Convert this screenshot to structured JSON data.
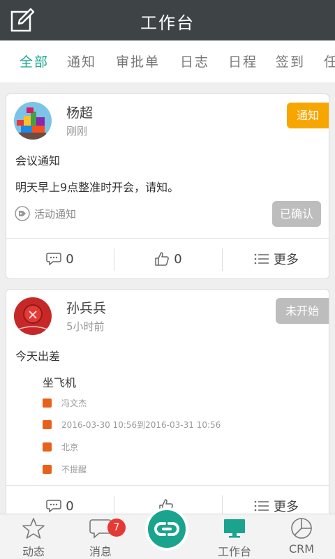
{
  "header": {
    "title": "工作台",
    "edit_icon": "edit-icon"
  },
  "tabs": [
    "全部",
    "通知",
    "审批单",
    "日志",
    "日程",
    "签到",
    "任"
  ],
  "active_tab": 0,
  "colors": {
    "accent": "#1aa48e",
    "header_bg": "#3e4346",
    "notice_badge": "#f7a600",
    "muted_badge": "#bdbdbd",
    "bullet": "#e8611a",
    "unread": "#e53935"
  },
  "card1": {
    "name": "杨超",
    "time": "刚刚",
    "badge": "通知",
    "title": "会议通知",
    "content": "明天早上9点整准时开会，请知。",
    "tag": "活动通知",
    "confirm": "已确认",
    "comments": "0",
    "likes": "0",
    "more": "更多"
  },
  "card2": {
    "name": "孙兵兵",
    "time": "5小时前",
    "badge": "未开始",
    "title": "今天出差",
    "subtitle": "坐飞机",
    "details": [
      "冯文杰",
      "2016-03-30 10:56到2016-03-31 10:56",
      "北京",
      "不提醒"
    ],
    "comments": "0",
    "more": "更多"
  },
  "bottom_nav": [
    {
      "label": "动态",
      "icon": "star-icon"
    },
    {
      "label": "消息",
      "icon": "chat-icon",
      "badge": "7"
    },
    {
      "label": "",
      "icon": "link-icon"
    },
    {
      "label": "工作台",
      "icon": "monitor-icon"
    },
    {
      "label": "CRM",
      "icon": "pie-chart-icon"
    }
  ]
}
